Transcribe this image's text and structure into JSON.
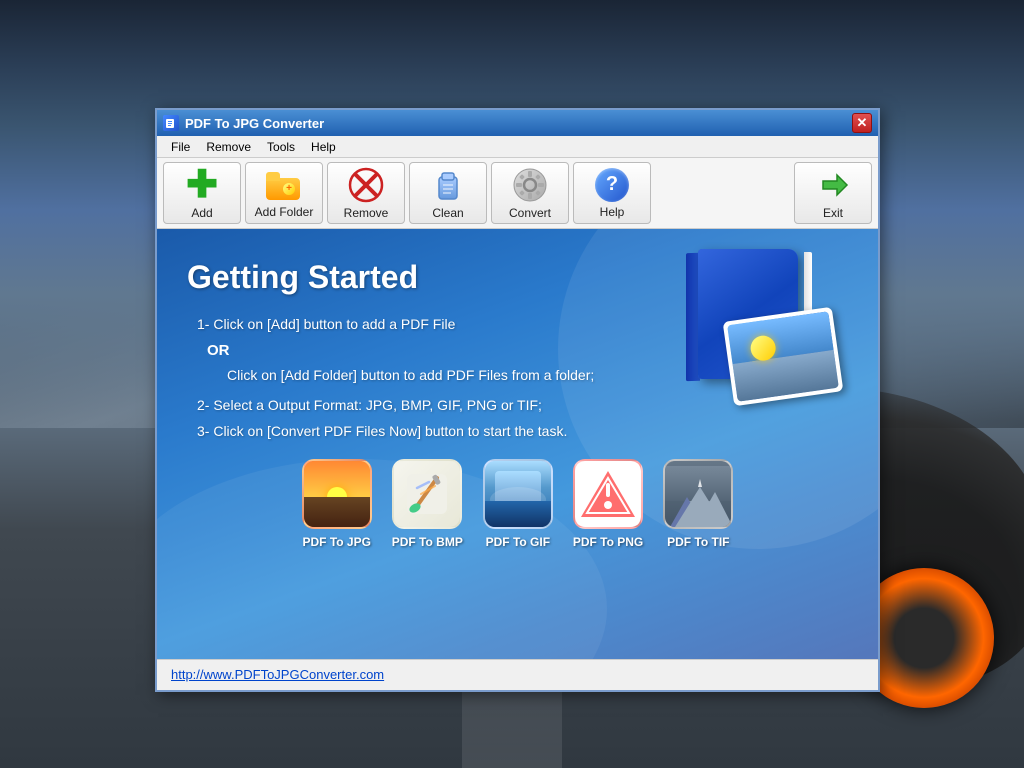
{
  "desktop": {
    "bg_color": "#4a5a6a"
  },
  "window": {
    "title": "PDF To JPG Converter",
    "close_label": "✕"
  },
  "menubar": {
    "items": [
      {
        "id": "menu-file",
        "label": "File"
      },
      {
        "id": "menu-remove",
        "label": "Remove"
      },
      {
        "id": "menu-tools",
        "label": "Tools"
      },
      {
        "id": "menu-help",
        "label": "Help"
      }
    ]
  },
  "toolbar": {
    "buttons": [
      {
        "id": "add",
        "label": "Add"
      },
      {
        "id": "add-folder",
        "label": "Add Folder"
      },
      {
        "id": "remove",
        "label": "Remove"
      },
      {
        "id": "clean",
        "label": "Clean"
      },
      {
        "id": "convert",
        "label": "Convert"
      },
      {
        "id": "help",
        "label": "Help"
      },
      {
        "id": "exit",
        "label": "Exit"
      }
    ]
  },
  "main": {
    "title": "Getting Started",
    "steps": [
      "1- Click on [Add] button to add a PDF File",
      "OR",
      "Click on [Add Folder] button to add PDF Files from a folder;",
      "2- Select a Output Format: JPG, BMP, GIF, PNG or TIF;",
      "3- Click on [Convert PDF Files Now] button to start the task."
    ],
    "format_icons": [
      {
        "id": "pdf-to-jpg",
        "label": "PDF To JPG",
        "type": "jpg"
      },
      {
        "id": "pdf-to-bmp",
        "label": "PDF To BMP",
        "type": "bmp"
      },
      {
        "id": "pdf-to-gif",
        "label": "PDF To GIF",
        "type": "gif"
      },
      {
        "id": "pdf-to-png",
        "label": "PDF To PNG",
        "type": "png"
      },
      {
        "id": "pdf-to-tif",
        "label": "PDF To TIF",
        "type": "tif"
      }
    ]
  },
  "statusbar": {
    "link_text": "http://www.PDFToJPGConverter.com",
    "link_url": "http://www.PDFToJPGConverter.com"
  }
}
